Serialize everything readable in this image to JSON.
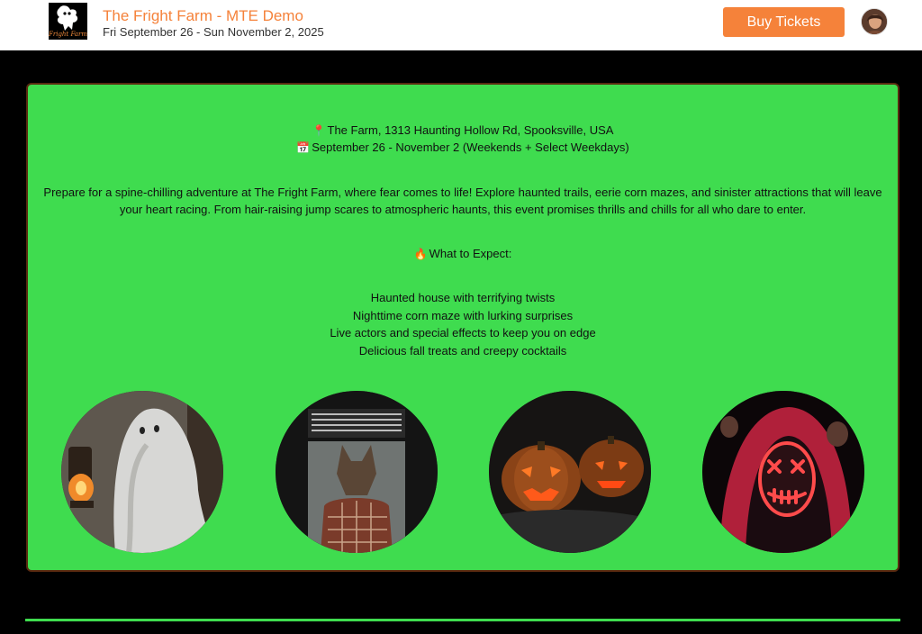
{
  "header": {
    "logo_text": "Fright Farm",
    "title": "The Fright Farm - MTE Demo",
    "dates": "Fri September 26 - Sun November 2, 2025",
    "buy_label": "Buy Tickets"
  },
  "details": {
    "location": "The Farm, 1313 Haunting Hollow Rd, Spooksville, USA",
    "schedule": "September 26 - November 2 (Weekends + Select Weekdays)",
    "description": "Prepare for a spine-chilling adventure at The Fright Farm, where fear comes to life! Explore haunted trails, eerie corn mazes, and sinister attractions that will leave your heart racing. From hair-raising jump scares to atmospheric haunts, this event promises thrills and chills for all who dare to enter.",
    "expect_heading": "What to Expect:",
    "expect_items": [
      "Haunted house with terrifying twists",
      "Nighttime corn maze with lurking surprises",
      "Live actors and special effects to keep you on edge",
      "Delicious fall treats and creepy cocktails"
    ]
  },
  "icons": {
    "location": "location-pin-icon",
    "calendar": "calendar-icon",
    "fire": "fire-icon"
  },
  "colors": {
    "brand": "#f5823a",
    "panel": "#3fdc4f",
    "background": "#000000"
  }
}
